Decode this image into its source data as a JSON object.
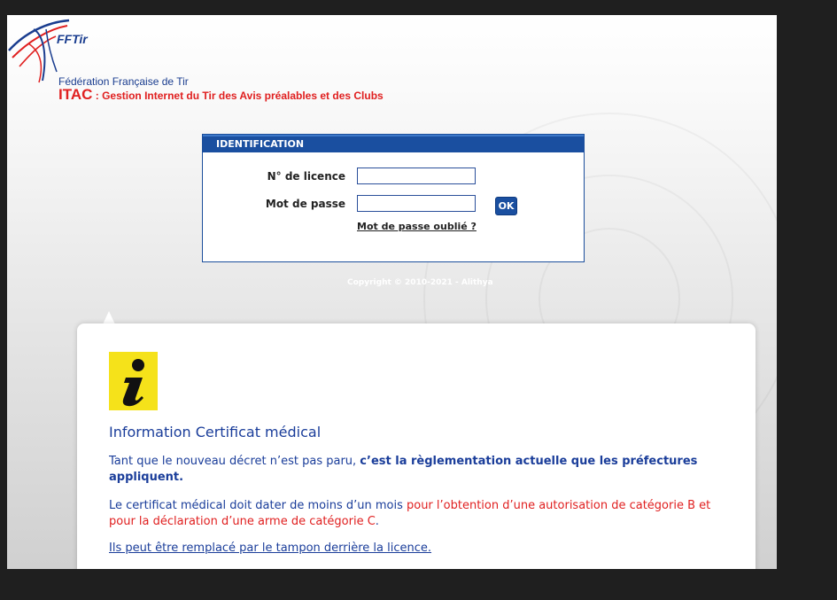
{
  "header": {
    "logo_text": "FFTir",
    "federation_name": "Fédération Française de Tir",
    "app_name": "ITAC",
    "app_desc": " : Gestion Internet du Tir des Avis préalables et des Clubs"
  },
  "login": {
    "header": "IDENTIFICATION",
    "licence_label": "N° de licence",
    "licence_value": "",
    "password_label": "Mot de passe",
    "password_value": "",
    "ok_label": "OK",
    "forgot_link": "Mot de passe oublié ?"
  },
  "copyright": "Copyright © 2010-2021 - Alithya",
  "info": {
    "icon": "info-icon",
    "title": "Information Certificat médical",
    "p1_normal": "Tant que le nouveau décret n’est pas paru, ",
    "p1_bold": "c’est la règlementation actuelle que les préfectures appliquent.",
    "p2_normal": "Le certificat médical doit dater de moins d’un mois ",
    "p2_red": "pour l’obtention d’une autorisation de catégorie B et pour la déclaration d’une arme de catégorie C",
    "p2_end": ".",
    "p3_link": "Ils peut être remplacé par le tampon derrière la licence."
  },
  "colors": {
    "brand_blue": "#1a4fa0",
    "accent_red": "#e02020",
    "info_yellow": "#f5e21a"
  }
}
